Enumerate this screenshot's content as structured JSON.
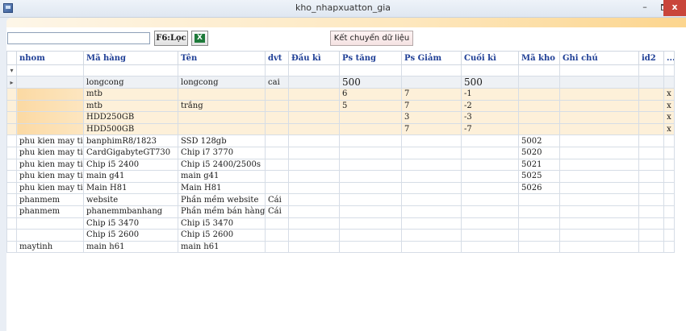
{
  "window": {
    "title": "kho_nhapxuatton_gia",
    "minimize_label": "–",
    "close_label": "x"
  },
  "toolbar": {
    "filter_value": "",
    "filter_button_label": "F6:Lọc",
    "excel_icon_text": "X",
    "transfer_button_label": "Kết chuyển dữ liệu"
  },
  "grid": {
    "filter_row_marker": "▾",
    "current_row_marker": "▸",
    "columns": [
      "nhom",
      "Mã hàng",
      "Tên",
      "dvt",
      "Đầu kì",
      "Ps tăng",
      "Ps Giảm",
      "Cuối kì",
      "Mã kho",
      "Ghi chú",
      "id2",
      "..."
    ],
    "rows": [
      {
        "style": "group",
        "marker": "▸",
        "cells": [
          "",
          "longcong",
          "longcong",
          "cai",
          "",
          "500",
          "",
          "500",
          "",
          "",
          "",
          ""
        ]
      },
      {
        "style": "hl",
        "marker": "",
        "cells": [
          "",
          "mtb",
          "",
          "",
          "",
          "6",
          "7",
          "-1",
          "",
          "",
          "",
          "x"
        ]
      },
      {
        "style": "hl",
        "marker": "",
        "cells": [
          "",
          "mtb",
          "trắng",
          "",
          "",
          "5",
          "7",
          "-2",
          "",
          "",
          "",
          "x"
        ]
      },
      {
        "style": "hl",
        "marker": "",
        "cells": [
          "",
          "HDD250GB",
          "",
          "",
          "",
          "",
          "3",
          "-3",
          "",
          "",
          "",
          "x"
        ]
      },
      {
        "style": "hl",
        "marker": "",
        "cells": [
          "",
          "HDD500GB",
          "",
          "",
          "",
          "",
          "7",
          "-7",
          "",
          "",
          "",
          "x"
        ]
      },
      {
        "style": "",
        "marker": "",
        "cells": [
          "phu kien may tinh",
          "banphimR8/1823",
          "SSD 128gb",
          "",
          "",
          "",
          "",
          "",
          "5002",
          "",
          "",
          ""
        ]
      },
      {
        "style": "",
        "marker": "",
        "cells": [
          "phu kien may tinh",
          "CardGigabyteGT730",
          "Chip i7 3770",
          "",
          "",
          "",
          "",
          "",
          "5020",
          "",
          "",
          ""
        ]
      },
      {
        "style": "",
        "marker": "",
        "cells": [
          "phu kien may tinh",
          "Chip i5 2400",
          "Chip i5 2400/2500s",
          "",
          "",
          "",
          "",
          "",
          "5021",
          "",
          "",
          ""
        ]
      },
      {
        "style": "",
        "marker": "",
        "cells": [
          "phu kien may tinh",
          "main g41",
          "main g41",
          "",
          "",
          "",
          "",
          "",
          "5025",
          "",
          "",
          ""
        ]
      },
      {
        "style": "",
        "marker": "",
        "cells": [
          "phu kien may tinh",
          "Main H81",
          "Main H81",
          "",
          "",
          "",
          "",
          "",
          "5026",
          "",
          "",
          ""
        ]
      },
      {
        "style": "",
        "marker": "",
        "cells": [
          "phanmem",
          "website",
          "Phần mềm website",
          "Cái",
          "",
          "",
          "",
          "",
          "",
          "",
          "",
          ""
        ]
      },
      {
        "style": "",
        "marker": "",
        "cells": [
          "phanmem",
          "phanemmbanhang",
          "Phần mềm bán hàng",
          "Cái",
          "",
          "",
          "",
          "",
          "",
          "",
          "",
          ""
        ]
      },
      {
        "style": "",
        "marker": "",
        "cells": [
          "",
          "Chip i5 3470",
          "Chip i5 3470",
          "",
          "",
          "",
          "",
          "",
          "",
          "",
          "",
          ""
        ]
      },
      {
        "style": "",
        "marker": "",
        "cells": [
          "",
          "Chip i5 2600",
          "Chip i5 2600",
          "",
          "",
          "",
          "",
          "",
          "",
          "",
          "",
          ""
        ]
      },
      {
        "style": "",
        "marker": "",
        "cells": [
          "maytinh",
          "main h61",
          "main h61",
          "",
          "",
          "",
          "",
          "",
          "",
          "",
          "",
          ""
        ]
      }
    ]
  }
}
